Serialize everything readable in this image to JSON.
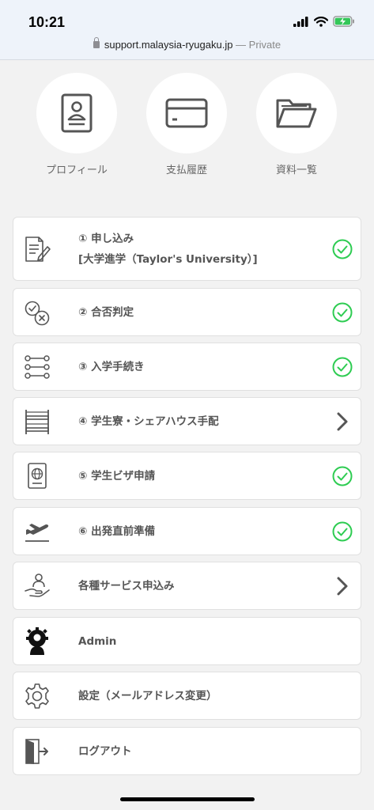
{
  "status_bar": {
    "time": "10:21"
  },
  "browser": {
    "url": "support.malaysia-ryugaku.jp",
    "separator": " — ",
    "mode": "Private"
  },
  "shortcuts": [
    {
      "label": "プロフィール",
      "icon": "profile-card-icon"
    },
    {
      "label": "支払履歴",
      "icon": "credit-card-icon"
    },
    {
      "label": "資料一覧",
      "icon": "folder-icon"
    }
  ],
  "menu": {
    "items": [
      {
        "line1": "① 申し込み",
        "line2": "[大学進学（Taylor's University）]",
        "status": "complete"
      },
      {
        "line1": "② 合否判定",
        "status": "complete"
      },
      {
        "line1": "③ 入学手続き",
        "status": "complete"
      },
      {
        "line1": "④ 学生寮・シェアハウス手配",
        "status": "arrow"
      },
      {
        "line1": "⑤ 学生ビザ申請",
        "status": "complete"
      },
      {
        "line1": "⑥ 出発直前準備",
        "status": "complete"
      },
      {
        "line1": "各種サービス申込み",
        "status": "arrow"
      },
      {
        "line1": "Admin"
      },
      {
        "line1": "設定（メールアドレス変更）"
      },
      {
        "line1": "ログアウト"
      }
    ]
  },
  "colors": {
    "check_green": "#2ecc52",
    "icon_gray": "#555555",
    "background": "#f2f2f2"
  }
}
